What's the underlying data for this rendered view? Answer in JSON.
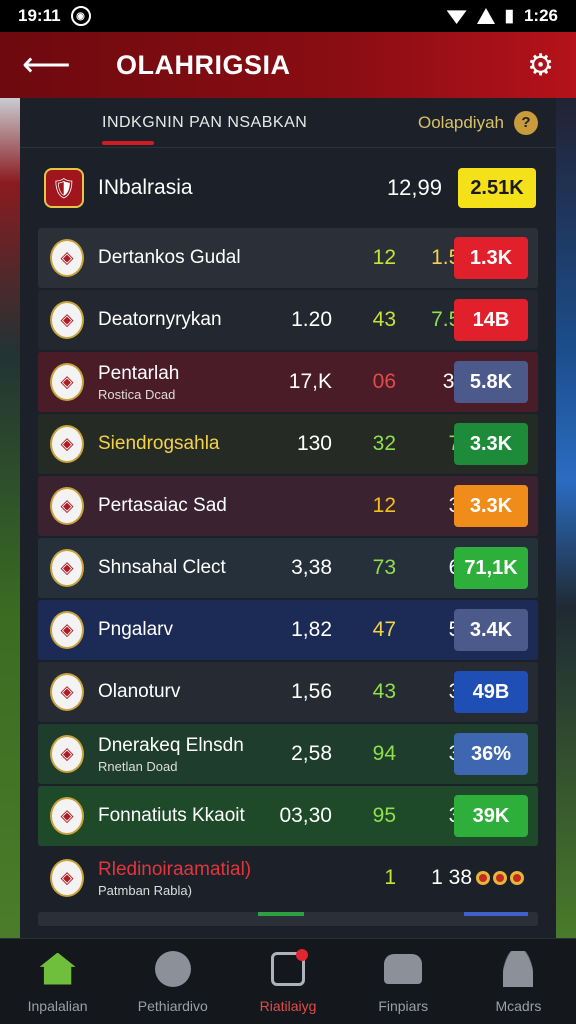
{
  "status": {
    "time": "19:11",
    "right_time": "1:26"
  },
  "app": {
    "back_icon": "back-arrow-icon",
    "title": "OLAHRIGSIA",
    "settings_icon": "gear-icon"
  },
  "subheader": {
    "tab": "INDKGNIN PAN NSABKAN",
    "right_label": "Oolapdiyah",
    "help": "?"
  },
  "header": {
    "name": "INbalrasia",
    "value": "12,99",
    "pill": "2.51K",
    "pill_color": "#f4e11a"
  },
  "rows": [
    {
      "name": "Dertankos Gudal",
      "subname": "",
      "c1": "",
      "c2": "12",
      "c2_color": "#c9e23a",
      "c3": "1.58",
      "c3_color": "#f2d24a",
      "pill": "1.3K",
      "pill_color": "#e2202b",
      "bg": "#2a2f38"
    },
    {
      "name": "Deatornyrykan",
      "subname": "",
      "c1": "1.20",
      "c2": "43",
      "c2_color": "#c9e23a",
      "c3": "7.55",
      "c3_color": "#8fe04a",
      "pill": "14B",
      "pill_color": "#e2202b",
      "bg": "#222730"
    },
    {
      "name": "Pentarlah",
      "subname": "Rostica Dcad",
      "c1": "17,K",
      "c2": "06",
      "c2_color": "#e24b4b",
      "c3": "3.6",
      "c3_color": "#ffffff",
      "pill": "5.8K",
      "pill_color": "#4b5a8a",
      "bg": "#4a1c28"
    },
    {
      "name": "Siendrogsahla",
      "subname": "",
      "c1": "130",
      "c2": "32",
      "c2_color": "#8fe04a",
      "c3": "70",
      "c3_color": "#8fe04a",
      "pill": "3.3K",
      "pill_color": "#1e8b3a",
      "bg": "#262a24",
      "name_color": "#f2d24a"
    },
    {
      "name": "Pertasaiac Sad",
      "subname": "",
      "c1": "",
      "c2": "12",
      "c2_color": "#f2c21a",
      "c3": "38",
      "c3_color": "#ffffff",
      "pill": "3.3K",
      "pill_color": "#f08c1a",
      "bg": "#3a2230"
    },
    {
      "name": "Shnsahal Clect",
      "subname": "",
      "c1": "3,38",
      "c2": "73",
      "c2_color": "#8fe04a",
      "c3": "68",
      "c3_color": "#ffffff",
      "pill": "71,1K",
      "pill_color": "#2eae3a",
      "bg": "#26303a"
    },
    {
      "name": "Pngalarv",
      "subname": "",
      "c1": "1,82",
      "c2": "47",
      "c2_color": "#f2d24a",
      "c3": "57",
      "c3_color": "#ffffff",
      "pill": "3.4K",
      "pill_color": "#4b5a8a",
      "bg": "#1b2b55"
    },
    {
      "name": "Olanoturv",
      "subname": "",
      "c1": "1,56",
      "c2": "43",
      "c2_color": "#8fe04a",
      "c3": "39",
      "c3_color": "#ffffff",
      "pill": "49B",
      "pill_color": "#1f4fb5",
      "bg": "#262a33"
    },
    {
      "name": "Dnerakeq Elnsdn",
      "subname": "Rnetlan Doad",
      "c1": "2,58",
      "c2": "94",
      "c2_color": "#8fe04a",
      "c3": "33",
      "c3_color": "#ffffff",
      "pill": "36%",
      "pill_color": "#3f66b0",
      "bg": "#1e3d2c"
    },
    {
      "name": "Fonnatiuts Kkaoit",
      "subname": "",
      "c1": "03,30",
      "c2": "95",
      "c2_color": "#8fe04a",
      "c3": "35",
      "c3_color": "#ffffff",
      "pill": "39K",
      "pill_color": "#2eae3a",
      "bg": "#1f4a2a"
    },
    {
      "name": "Rledinoiraamatial)",
      "subname": "Patmban Rabla)",
      "c1": "",
      "c2": "1",
      "c2_color": "#c9e23a",
      "c3": "1 38",
      "c3_color": "#ffffff",
      "pill": "",
      "pill_color": "",
      "bg": "#1c2129",
      "name_color": "#e2363c",
      "dots": true
    }
  ],
  "nav": [
    {
      "label": "Inpalalian",
      "icon": "home-icon",
      "active": false
    },
    {
      "label": "Pethiardivo",
      "icon": "ball-icon",
      "active": false
    },
    {
      "label": "Riatilaiyg",
      "icon": "bag-icon",
      "active": true
    },
    {
      "label": "Finpiars",
      "icon": "group-icon",
      "active": false
    },
    {
      "label": "Mcadrs",
      "icon": "person-icon",
      "active": false
    }
  ]
}
